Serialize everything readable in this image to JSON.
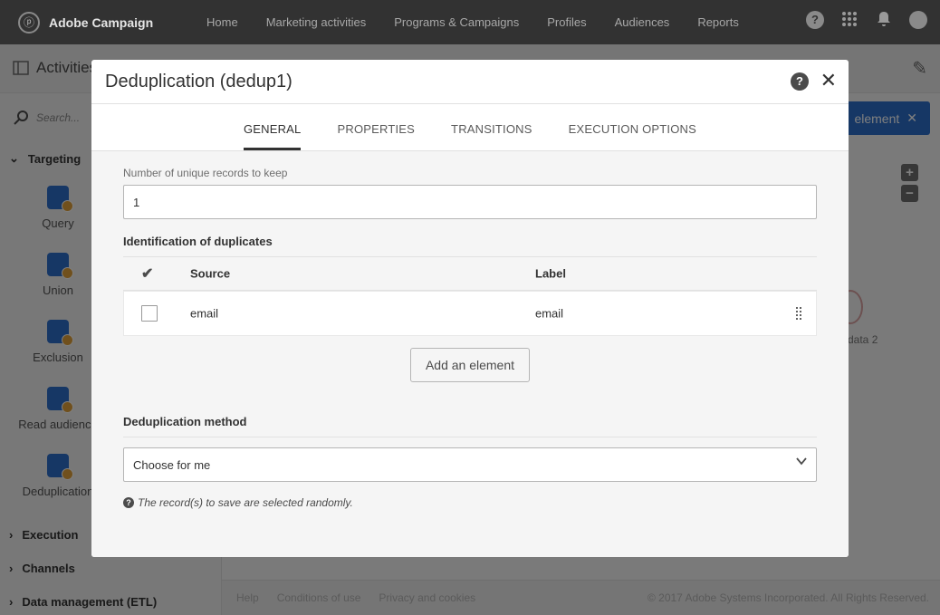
{
  "app": {
    "name": "Adobe Campaign"
  },
  "nav": {
    "items": [
      "Home",
      "Marketing activities",
      "Programs & Campaigns",
      "Profiles",
      "Audiences",
      "Reports"
    ]
  },
  "subbar": {
    "title": "Activities"
  },
  "sidebar": {
    "search_placeholder": "Search...",
    "sections": {
      "targeting": "Targeting",
      "execution": "Execution",
      "channels": "Channels",
      "data_management": "Data management (ETL)"
    },
    "tools": [
      "Query",
      "Union",
      "Exclusion",
      "Read audience",
      "Deduplication"
    ]
  },
  "canvas": {
    "add_element_label": "element",
    "node_label": "data 2"
  },
  "footer": {
    "help": "Help",
    "conditions": "Conditions of use",
    "privacy": "Privacy and cookies",
    "copyright": "© 2017 Adobe Systems Incorporated. All Rights Reserved."
  },
  "dialog": {
    "title": "Deduplication (dedup1)",
    "tabs": [
      "GENERAL",
      "PROPERTIES",
      "TRANSITIONS",
      "EXECUTION OPTIONS"
    ],
    "active_tab": "GENERAL",
    "unique_records_label": "Number of unique records to keep",
    "unique_records_value": "1",
    "identification_heading": "Identification of duplicates",
    "table": {
      "headers": {
        "source": "Source",
        "label": "Label"
      },
      "rows": [
        {
          "source": "email",
          "label": "email",
          "checked": false
        }
      ]
    },
    "add_element_button": "Add an element",
    "method_heading": "Deduplication method",
    "method_value": "Choose for me",
    "info_text": "The record(s) to save are selected randomly."
  },
  "colors": {
    "topbar": "#323232",
    "accent_blue": "#2d6fcb",
    "overlay": "rgba(0,0,0,0.5)"
  }
}
